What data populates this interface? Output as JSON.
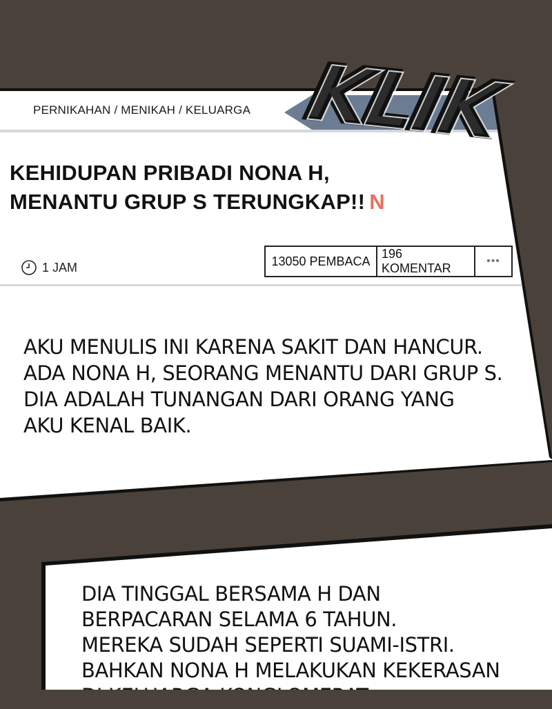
{
  "post": {
    "category": "PERNIKAHAN / MENIKAH / KELUARGA",
    "title_lines": [
      "KEHIDUPAN PRIBADI NONA H,",
      "MENANTU GRUP S TERUNGKAP!!"
    ],
    "new_badge": "N",
    "time": "1 JAM",
    "readers": "13050 PEMBACA",
    "comments": "196 KOMENTAR",
    "more_label": "•••",
    "body_lines": [
      "AKU MENULIS INI KARENA SAKIT DAN HANCUR.",
      "ADA NONA H, SEORANG MENANTU DARI GRUP S.",
      "DIA ADALAH TUNANGAN DARI ORANG YANG",
      "AKU KENAL BAIK."
    ]
  },
  "continuation": {
    "lines": [
      "DIA TINGGAL BERSAMA H DAN",
      "BERPACARAN SELAMA 6 TAHUN.",
      "MEREKA SUDAH SEPERTI SUAMI-ISTRI.",
      "BAHKAN NONA H MELAKUKAN KEKERASAN",
      "DI KELUARGA KONGLOMERAT"
    ]
  },
  "sound_effect": "KLIK",
  "icons": {
    "clock": "clock-icon",
    "more": "more-icon"
  },
  "colors": {
    "accent_new": "#e8705c",
    "tag": "#6c7c93",
    "background": "#4a423a"
  }
}
